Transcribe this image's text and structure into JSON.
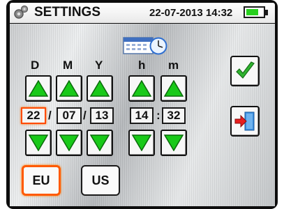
{
  "header": {
    "title": "SETTINGS",
    "datetime": "22-07-2013 14:32",
    "icon": "gear-icon",
    "battery": {
      "level": 0.75,
      "color": "#28d01e"
    }
  },
  "date_time": {
    "columns": [
      "D",
      "M",
      "Y",
      "h",
      "m"
    ],
    "values": [
      "22",
      "07",
      "13",
      "14",
      "32"
    ],
    "separators": [
      "/",
      "/",
      ":"
    ]
  },
  "format": {
    "options": [
      "EU",
      "US"
    ],
    "selected": "EU"
  },
  "colors": {
    "arrow_fill": "#19c919",
    "selection": "#ff4a00",
    "confirm": "#2fb42f",
    "exit": "#e81f1f"
  }
}
